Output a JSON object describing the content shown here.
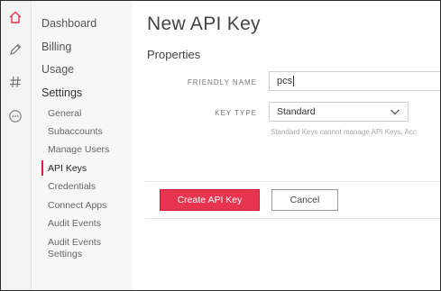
{
  "colors": {
    "accent": "#e8344e",
    "rail_bg": "#f3f3f3",
    "sidebar_bg": "#f7f7f7"
  },
  "rail": {
    "icons": [
      "home-icon",
      "pen-icon",
      "hash-icon",
      "more-icon"
    ]
  },
  "sidebar": {
    "main_items": [
      {
        "label": "Dashboard"
      },
      {
        "label": "Billing"
      },
      {
        "label": "Usage"
      },
      {
        "label": "Settings"
      }
    ],
    "settings_items": [
      {
        "label": "General"
      },
      {
        "label": "Subaccounts"
      },
      {
        "label": "Manage Users"
      },
      {
        "label": "API Keys",
        "active": true
      },
      {
        "label": "Credentials"
      },
      {
        "label": "Connect Apps"
      },
      {
        "label": "Audit Events"
      },
      {
        "label": "Audit Events Settings"
      }
    ]
  },
  "main": {
    "title": "New API Key",
    "section": "Properties",
    "fields": {
      "friendly_name_label": "FRIENDLY NAME",
      "friendly_name_value": "pcs",
      "key_type_label": "KEY TYPE",
      "key_type_value": "Standard",
      "key_type_hint": "Standard Keys cannot manage API Keys, Acc"
    },
    "actions": {
      "create_label": "Create API Key",
      "cancel_label": "Cancel"
    }
  }
}
